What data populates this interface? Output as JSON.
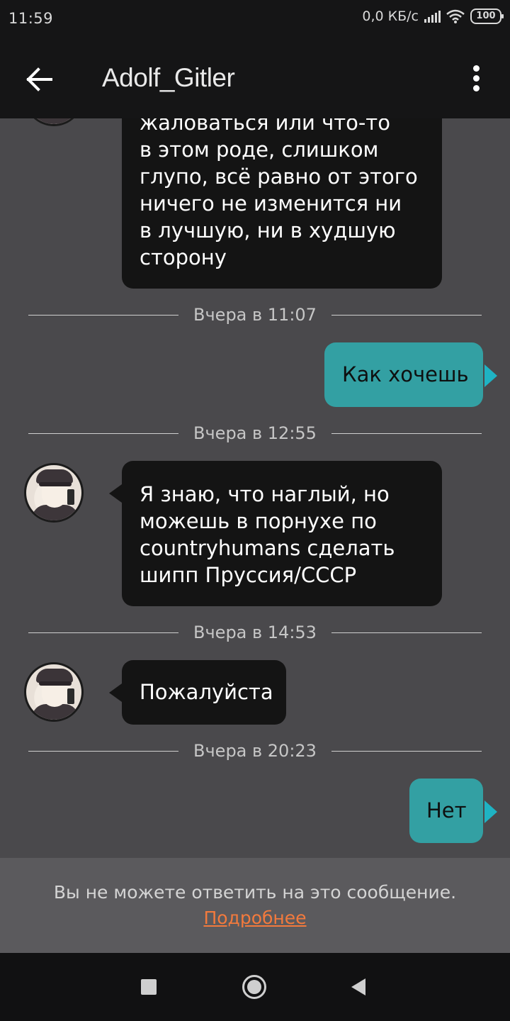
{
  "status_bar": {
    "time": "11:59",
    "network_speed": "0,0 КБ/с",
    "battery": "100"
  },
  "header": {
    "title": "Adolf_Gitler"
  },
  "messages": [
    {
      "direction": "incoming",
      "lines": [
        "жаловаться или что-то",
        "в этом роде, слишком",
        "глупо, всё равно от этого",
        "ничего не изменится ни",
        "в лучшую, ни в худшую",
        "сторону"
      ]
    },
    {
      "divider": "Вчера в 11:07"
    },
    {
      "direction": "outgoing",
      "text": "Как хочешь"
    },
    {
      "divider": "Вчера в 12:55"
    },
    {
      "direction": "incoming",
      "lines": [
        "Я знаю, что наглый, но",
        "можешь в порнухе по",
        "countryhumans сделать",
        "шипп Пруссия/СССР"
      ]
    },
    {
      "divider": "Вчера в 14:53"
    },
    {
      "direction": "incoming",
      "text": "Пожалуйста"
    },
    {
      "divider": "Вчера в 20:23"
    },
    {
      "direction": "outgoing",
      "text": "Нет"
    }
  ],
  "footer": {
    "message": "Вы не можете ответить на это сообщение.",
    "link": "Подробнее"
  },
  "colors": {
    "background": "#4a494c",
    "bar": "#151516",
    "incoming_bubble": "#141414",
    "outgoing_bubble": "#33a0a3",
    "link": "#f37a3d"
  }
}
